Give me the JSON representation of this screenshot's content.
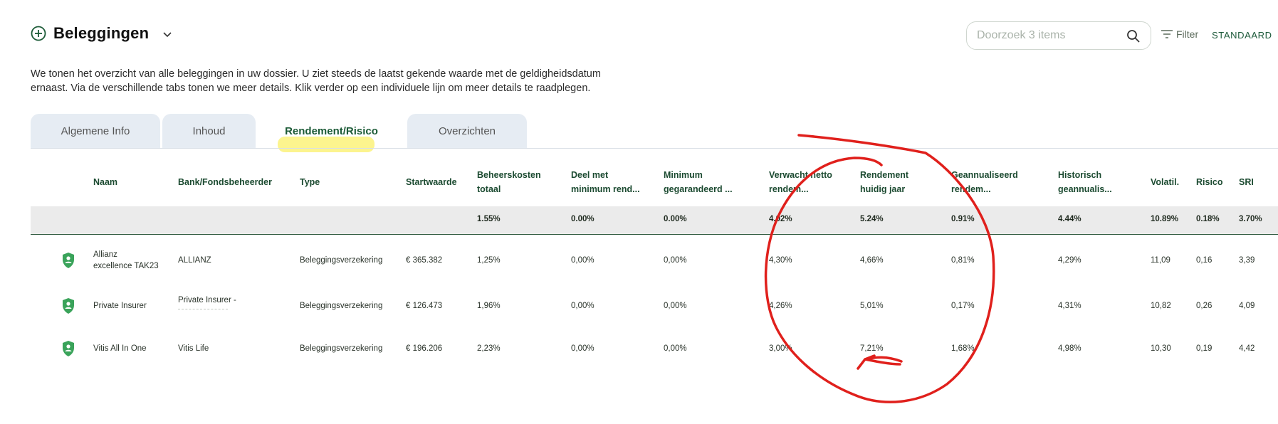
{
  "header": {
    "title": "Beleggingen"
  },
  "search": {
    "placeholder": "Doorzoek 3 items"
  },
  "toolbar": {
    "filter_label": "Filter",
    "standaard_label": "STANDAARD"
  },
  "intro": {
    "line1": "We tonen het overzicht van alle beleggingen in uw dossier. U ziet steeds de laatst gekende waarde met de geldigheidsdatum",
    "line2": "ernaast. Via de verschillende tabs tonen we meer details. Klik verder op een individuele lijn om meer details te raadplegen."
  },
  "tabs": [
    "Algemene Info",
    "Inhoud",
    "Rendement/Risico",
    "Overzichten"
  ],
  "active_tab": "Rendement/Risico",
  "columns": {
    "naam": "Naam",
    "bank": "Bank/Fondsbeheerder",
    "type": "Type",
    "start": "Startwaarde",
    "beheer": [
      "Beheerskosten",
      "totaal"
    ],
    "deel": [
      "Deel met",
      "minimum rend..."
    ],
    "minimum": [
      "Minimum",
      "gegarandeerd ..."
    ],
    "verwacht": [
      "Verwacht netto",
      "rendem..."
    ],
    "rendement": [
      "Rendement",
      "huidig jaar"
    ],
    "geann": [
      "Geannualiseerd",
      "rendem..."
    ],
    "hist": [
      "Historisch",
      "geannualis..."
    ],
    "vol": "Volatil.",
    "risico": "Risico",
    "sri": "SRI"
  },
  "summary": {
    "beheer": "1.55%",
    "deel": "0.00%",
    "minimum": "0.00%",
    "verwacht": "4.02%",
    "rendement": "5.24%",
    "geann": "0.91%",
    "hist": "4.44%",
    "vol": "10.89%",
    "risico": "0.18%",
    "sri": "3.70%"
  },
  "rows": [
    {
      "naam": [
        "Allianz",
        "excellence TAK23"
      ],
      "bank": "ALLIANZ",
      "type": "Beleggingsverzekering",
      "start": "€ 365.382",
      "beheer": "1,25%",
      "deel": "0,00%",
      "minimum": "0,00%",
      "verwacht": "4,30%",
      "rendement": "4,66%",
      "geann": "0,81%",
      "hist": "4,29%",
      "vol": "11,09",
      "risico": "0,16",
      "sri": "3,39"
    },
    {
      "naam": [
        "Private Insurer"
      ],
      "bank": "Private Insurer -",
      "type": "Beleggingsverzekering",
      "start": "€ 126.473",
      "beheer": "1,96%",
      "deel": "0,00%",
      "minimum": "0,00%",
      "verwacht": "4,26%",
      "rendement": "5,01%",
      "geann": "0,17%",
      "hist": "4,31%",
      "vol": "10,82",
      "risico": "0,26",
      "sri": "4,09"
    },
    {
      "naam": [
        "Vitis All In One"
      ],
      "bank": "Vitis Life",
      "type": "Beleggingsverzekering",
      "start": "€ 196.206",
      "beheer": "2,23%",
      "deel": "0,00%",
      "minimum": "0,00%",
      "verwacht": "3,00%",
      "rendement": "7,21%",
      "geann": "1,68%",
      "hist": "4,98%",
      "vol": "10,30",
      "risico": "0,19",
      "sri": "4,42"
    }
  ],
  "colors": {
    "brand_green": "#1b5a36",
    "shield_green": "#3aa35a",
    "annotation_red": "#e0201c",
    "highlight_yellow": "#fbf27a"
  },
  "icons": [
    "plus-circle-icon",
    "chevron-down-icon",
    "search-icon",
    "filter-icon",
    "shield-icon"
  ]
}
